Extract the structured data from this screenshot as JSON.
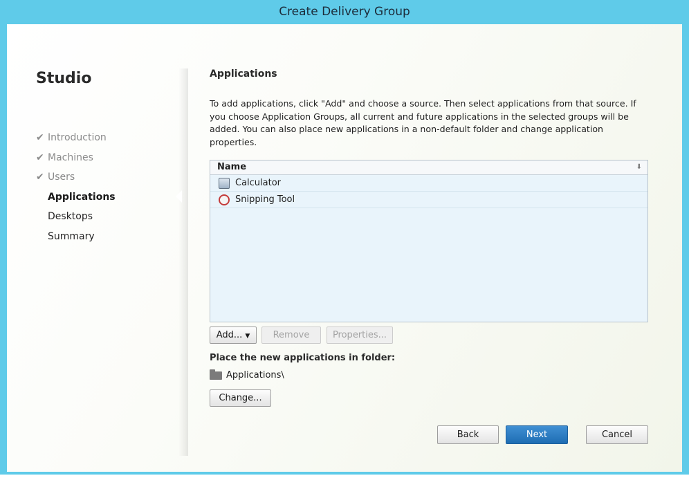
{
  "window": {
    "title": "Create Delivery Group"
  },
  "sidebar": {
    "app_title": "Studio",
    "steps": [
      {
        "label": "Introduction",
        "state": "done"
      },
      {
        "label": "Machines",
        "state": "done"
      },
      {
        "label": "Users",
        "state": "done"
      },
      {
        "label": "Applications",
        "state": "current"
      },
      {
        "label": "Desktops",
        "state": "todo"
      },
      {
        "label": "Summary",
        "state": "todo"
      }
    ]
  },
  "main": {
    "section_title": "Applications",
    "description": "To add applications, click \"Add\" and choose a source. Then select applications from that source. If you choose Application Groups, all current and future applications in the selected groups will be added. You can also place new applications in a non-default folder and change application properties.",
    "list": {
      "column_header": "Name",
      "rows": [
        {
          "name": "Calculator",
          "icon": "calculator-icon"
        },
        {
          "name": "Snipping Tool",
          "icon": "snipping-tool-icon"
        }
      ]
    },
    "buttons": {
      "add": "Add...",
      "remove": "Remove",
      "properties": "Properties..."
    },
    "folder": {
      "label": "Place the new applications in folder:",
      "path": "Applications\\",
      "change_button": "Change..."
    }
  },
  "footer": {
    "back": "Back",
    "next": "Next",
    "cancel": "Cancel"
  },
  "colors": {
    "title_bar": "#5fcbe9",
    "primary_button": "#2a7cc4"
  }
}
